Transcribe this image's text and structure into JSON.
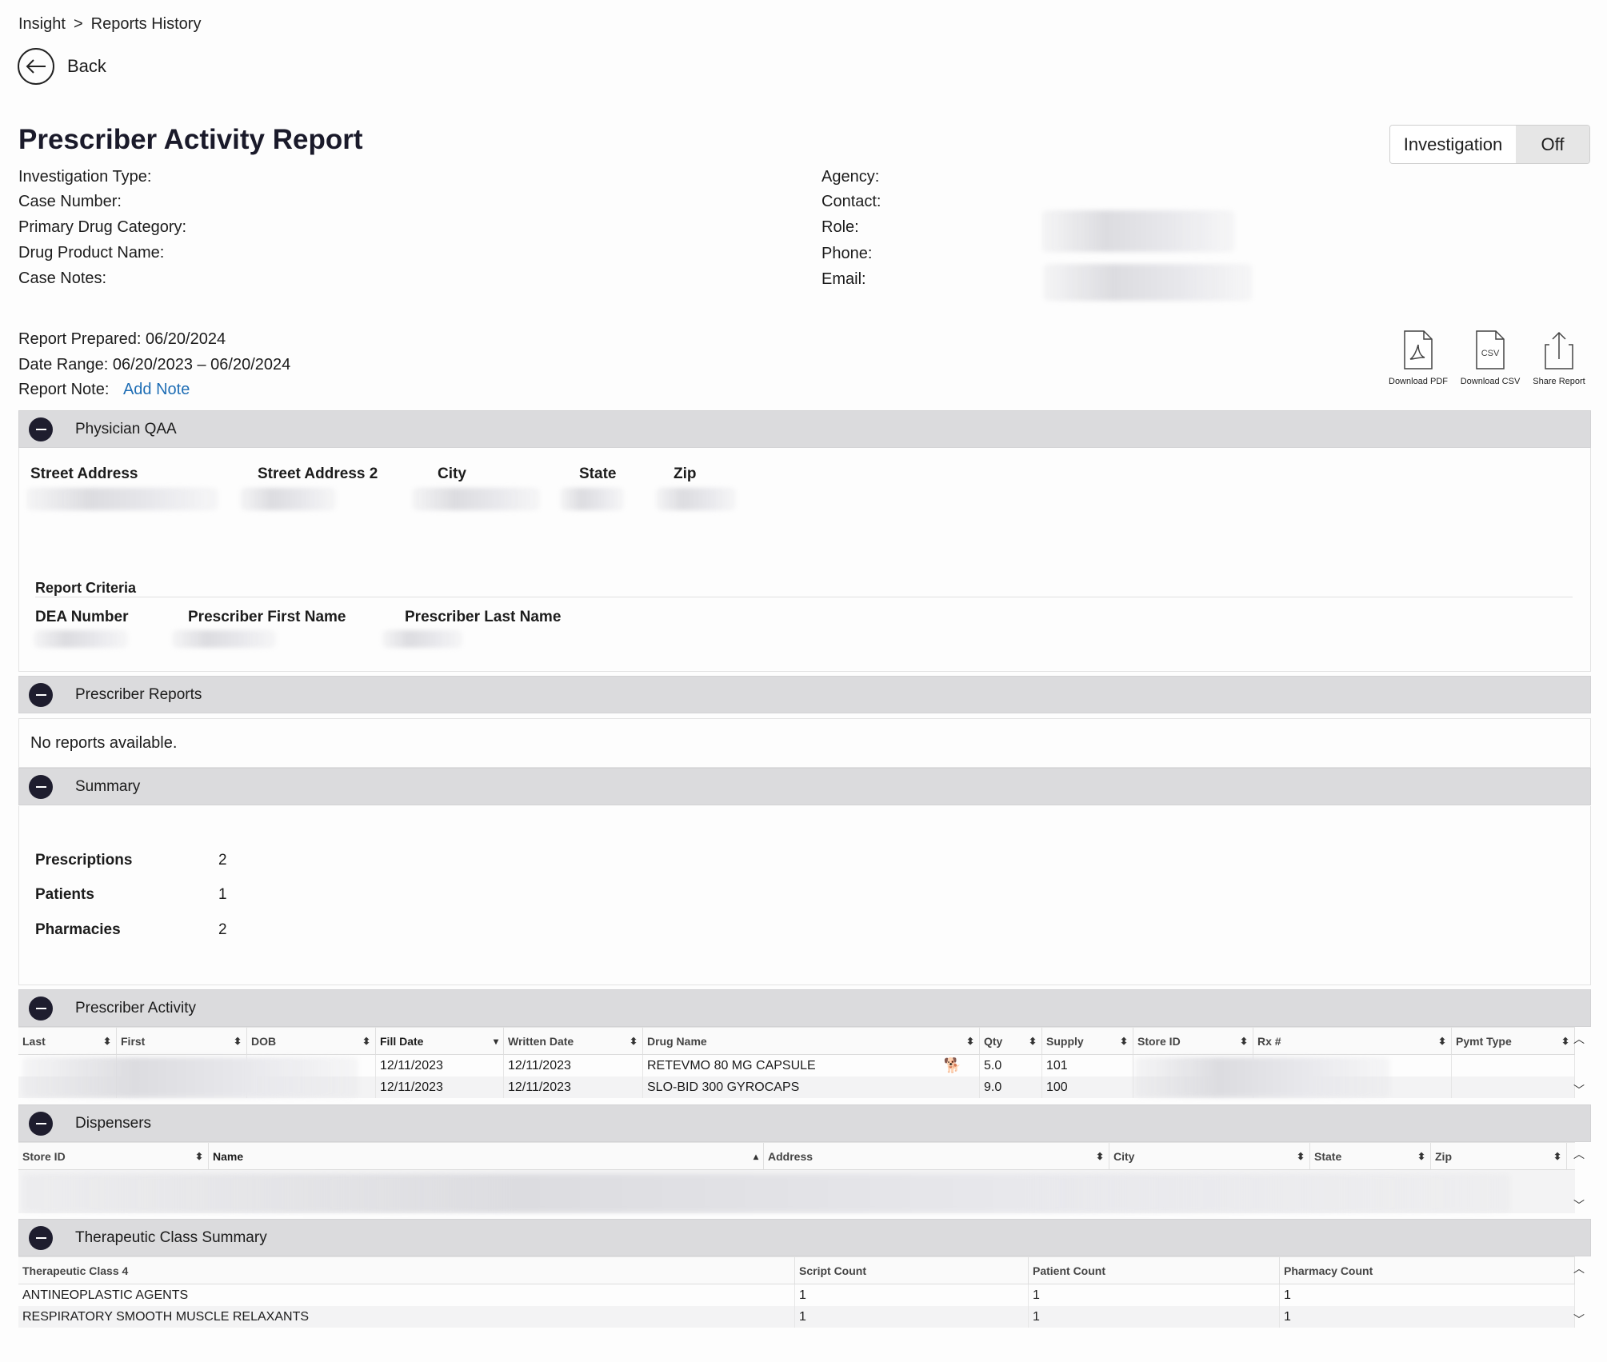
{
  "breadcrumb": {
    "root": "Insight",
    "sep": ">",
    "current": "Reports History"
  },
  "back_label": "Back",
  "title": "Prescriber Activity Report",
  "toggle": {
    "label": "Investigation",
    "value": "Off"
  },
  "info_left": [
    "Investigation Type:",
    "Case Number:",
    "Primary Drug Category:",
    "Drug Product Name:",
    "Case Notes:"
  ],
  "info_right": [
    "Agency:",
    "Contact:",
    "Role:",
    "Phone:",
    "Email:"
  ],
  "report_meta": {
    "prepared": "Report Prepared: 06/20/2024",
    "range": "Date Range: 06/20/2023 – 06/20/2024",
    "note_label": "Report Note:",
    "note_link": "Add Note"
  },
  "tools": {
    "pdf": "Download PDF",
    "csv": "Download CSV",
    "share": "Share Report",
    "csv_glyph": "CSV"
  },
  "physician": {
    "title": "Physician QAA",
    "address_cols": [
      "Street Address",
      "Street Address 2",
      "City",
      "State",
      "Zip"
    ],
    "criteria_title": "Report Criteria",
    "criteria_cols": [
      "DEA Number",
      "Prescriber First Name",
      "Prescriber Last Name"
    ]
  },
  "prescriber_reports": {
    "title": "Prescriber Reports",
    "empty": "No reports available."
  },
  "summary": {
    "title": "Summary",
    "rows": [
      {
        "label": "Prescriptions",
        "value": "2"
      },
      {
        "label": "Patients",
        "value": "1"
      },
      {
        "label": "Pharmacies",
        "value": "2"
      }
    ]
  },
  "activity": {
    "title": "Prescriber Activity",
    "columns": [
      "Last",
      "First",
      "DOB",
      "Fill Date",
      "Written Date",
      "Drug Name",
      "Qty",
      "Supply",
      "Store ID",
      "Rx #",
      "Pymt Type"
    ],
    "rows": [
      {
        "fill": "12/11/2023",
        "written": "12/11/2023",
        "drug": "RETEVMO 80 MG CAPSULE",
        "qty": "5.0",
        "supply": "101"
      },
      {
        "fill": "12/11/2023",
        "written": "12/11/2023",
        "drug": "SLO-BID 300 GYROCAPS",
        "qty": "9.0",
        "supply": "100"
      }
    ]
  },
  "dispensers": {
    "title": "Dispensers",
    "columns": [
      "Store ID",
      "Name",
      "Address",
      "City",
      "State",
      "Zip"
    ]
  },
  "therapeutic": {
    "title": "Therapeutic Class Summary",
    "columns": [
      "Therapeutic Class 4",
      "Script Count",
      "Patient Count",
      "Pharmacy Count"
    ],
    "rows": [
      {
        "cls": "ANTINEOPLASTIC AGENTS",
        "script": "1",
        "patient": "1",
        "pharmacy": "1"
      },
      {
        "cls": "RESPIRATORY SMOOTH MUSCLE RELAXANTS",
        "script": "1",
        "patient": "1",
        "pharmacy": "1"
      }
    ]
  }
}
